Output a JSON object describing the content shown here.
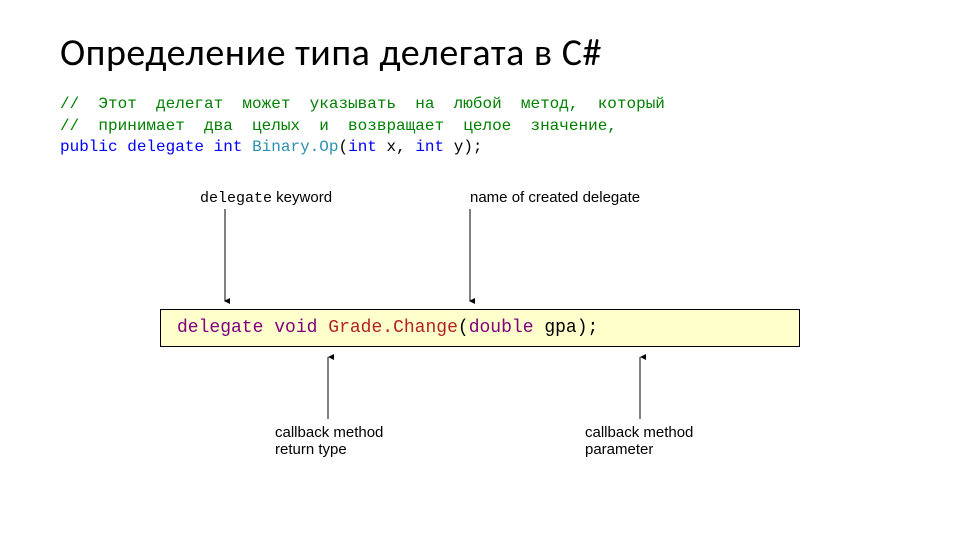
{
  "title": "Определение типа делегата в С#",
  "code": {
    "comment1": "//  Этот  делегат  может  указывать  на  любой  метод,  который",
    "comment2": "//  принимает  два  целых  и  возвращает  целое  значение,",
    "kw_public": "public",
    "kw_delegate": "delegate",
    "kw_int1": "int",
    "type_name": "Binary.Op",
    "after_type": "(",
    "kw_int2": "int",
    "mid": " x, ",
    "kw_int3": "int",
    "tail": " y);"
  },
  "diagram": {
    "top_left_mono": "delegate",
    "top_left_text": " keyword",
    "top_right_text": "name of created delegate",
    "decl": {
      "kw_delegate": "delegate",
      "kw_void": "void",
      "name": "Grade.Change",
      "open": "(",
      "kw_double": "double",
      "param": " gpa);"
    },
    "bottom_left_l1": "callback method",
    "bottom_left_l2": "return type",
    "bottom_right_l1": "callback method",
    "bottom_right_l2": "parameter"
  }
}
